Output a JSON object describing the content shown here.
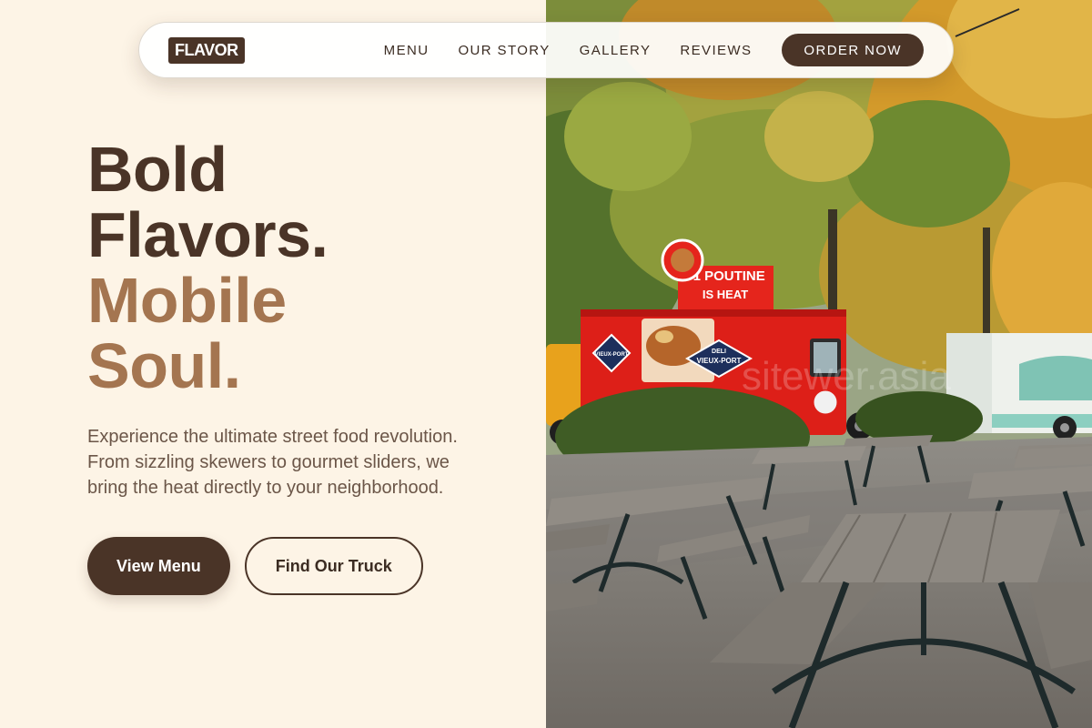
{
  "brand": {
    "logo_text": "FLAVOR"
  },
  "nav": {
    "links": [
      "MENU",
      "OUR STORY",
      "GALLERY",
      "REVIEWS"
    ],
    "order_label": "ORDER NOW"
  },
  "hero": {
    "headline_line1": "Bold",
    "headline_line2": "Flavors.",
    "headline_line3": "Mobile",
    "headline_line4": "Soul.",
    "lead": "Experience the ultimate street food revolution. From sizzling skewers to gourmet sliders, we bring the heat directly to your neighborhood.",
    "primary_cta": "View Menu",
    "secondary_cta": "Find Our Truck"
  },
  "photo": {
    "sign_text": "#1 POUTINE",
    "sign_subtext": "IS HEAT",
    "truck_brand": "VIEUX-PORT",
    "truck_prefix": "DELI",
    "watermark": "sitewer.asia"
  },
  "colors": {
    "page_background": "#fdf4e6",
    "primary_brown": "#4a3427",
    "accent_tan": "#a47550",
    "body_text": "#6b5648"
  }
}
